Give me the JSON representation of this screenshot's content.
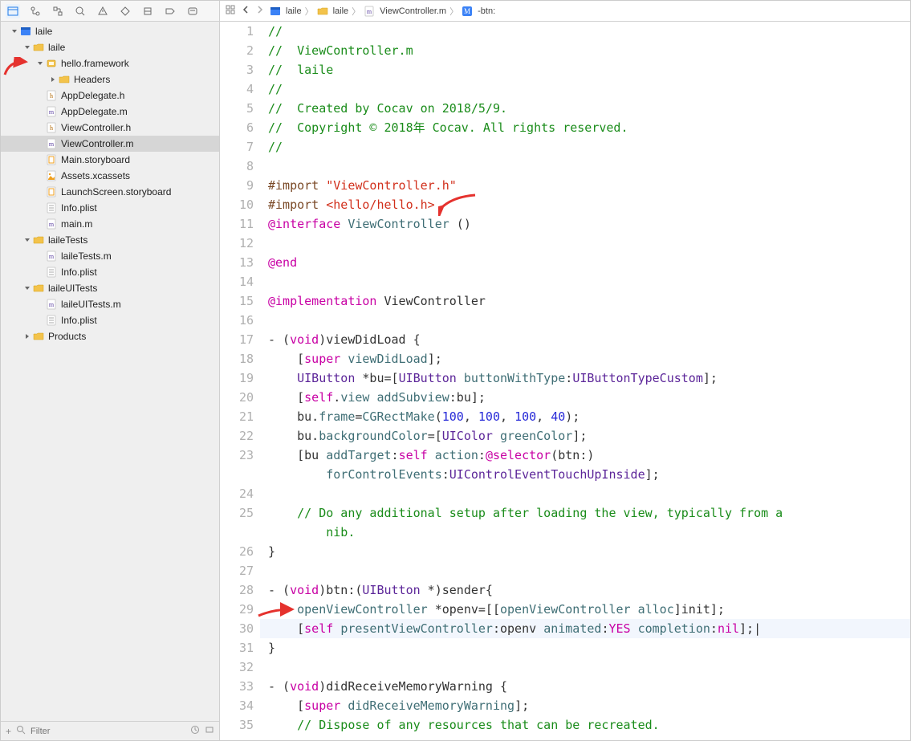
{
  "toolbar": {
    "filter_placeholder": "Filter"
  },
  "breadcrumb": {
    "items": [
      "laile",
      "laile",
      "ViewController.m",
      "-btn:"
    ]
  },
  "tree": [
    {
      "depth": 0,
      "icon": "proj",
      "label": "laile",
      "disclosure": "open"
    },
    {
      "depth": 1,
      "icon": "folder",
      "label": "laile",
      "disclosure": "open"
    },
    {
      "depth": 2,
      "icon": "framework",
      "label": "hello.framework",
      "disclosure": "open",
      "arrow": true
    },
    {
      "depth": 3,
      "icon": "folder",
      "label": "Headers",
      "disclosure": "closed"
    },
    {
      "depth": 2,
      "icon": "h",
      "label": "AppDelegate.h"
    },
    {
      "depth": 2,
      "icon": "m",
      "label": "AppDelegate.m"
    },
    {
      "depth": 2,
      "icon": "h",
      "label": "ViewController.h"
    },
    {
      "depth": 2,
      "icon": "m",
      "label": "ViewController.m",
      "selected": true
    },
    {
      "depth": 2,
      "icon": "storyboard",
      "label": "Main.storyboard"
    },
    {
      "depth": 2,
      "icon": "xcassets",
      "label": "Assets.xcassets"
    },
    {
      "depth": 2,
      "icon": "storyboard",
      "label": "LaunchScreen.storyboard"
    },
    {
      "depth": 2,
      "icon": "plist",
      "label": "Info.plist"
    },
    {
      "depth": 2,
      "icon": "m",
      "label": "main.m"
    },
    {
      "depth": 1,
      "icon": "folder",
      "label": "laileTests",
      "disclosure": "open"
    },
    {
      "depth": 2,
      "icon": "m",
      "label": "laileTests.m"
    },
    {
      "depth": 2,
      "icon": "plist",
      "label": "Info.plist"
    },
    {
      "depth": 1,
      "icon": "folder",
      "label": "laileUITests",
      "disclosure": "open"
    },
    {
      "depth": 2,
      "icon": "m",
      "label": "laileUITests.m"
    },
    {
      "depth": 2,
      "icon": "plist",
      "label": "Info.plist"
    },
    {
      "depth": 1,
      "icon": "folder",
      "label": "Products",
      "disclosure": "closed"
    }
  ],
  "code": [
    {
      "n": 1,
      "t": [
        [
          "//",
          "comment"
        ]
      ]
    },
    {
      "n": 2,
      "t": [
        [
          "//  ViewController.m",
          "comment"
        ]
      ]
    },
    {
      "n": 3,
      "t": [
        [
          "//  laile",
          "comment"
        ]
      ]
    },
    {
      "n": 4,
      "t": [
        [
          "//",
          "comment"
        ]
      ]
    },
    {
      "n": 5,
      "t": [
        [
          "//  Created by Cocav on 2018/5/9.",
          "comment"
        ]
      ]
    },
    {
      "n": 6,
      "t": [
        [
          "//  Copyright © 2018年 Cocav. All rights reserved.",
          "comment"
        ]
      ]
    },
    {
      "n": 7,
      "t": [
        [
          "//",
          "comment"
        ]
      ]
    },
    {
      "n": 8,
      "t": [
        [
          "",
          ""
        ]
      ]
    },
    {
      "n": 9,
      "t": [
        [
          "#import ",
          "import"
        ],
        [
          "\"ViewController.h\"",
          "string"
        ]
      ]
    },
    {
      "n": 10,
      "t": [
        [
          "#import ",
          "import"
        ],
        [
          "<hello/hello.h>",
          "string"
        ]
      ],
      "arrow": "right"
    },
    {
      "n": 11,
      "t": [
        [
          "@interface",
          "keyword"
        ],
        [
          " ",
          ""
        ],
        [
          "ViewController",
          "id"
        ],
        [
          " ()",
          ""
        ]
      ]
    },
    {
      "n": 12,
      "t": [
        [
          "",
          ""
        ]
      ]
    },
    {
      "n": 13,
      "t": [
        [
          "@end",
          "keyword"
        ]
      ]
    },
    {
      "n": 14,
      "t": [
        [
          "",
          ""
        ]
      ]
    },
    {
      "n": 15,
      "t": [
        [
          "@implementation",
          "keyword"
        ],
        [
          " ViewController",
          ""
        ]
      ]
    },
    {
      "n": 16,
      "t": [
        [
          "",
          ""
        ]
      ]
    },
    {
      "n": 17,
      "t": [
        [
          "- (",
          ""
        ],
        [
          "void",
          "keyword"
        ],
        [
          ")viewDidLoad {",
          ""
        ]
      ]
    },
    {
      "n": 18,
      "t": [
        [
          "    [",
          ""
        ],
        [
          "super",
          "keyword"
        ],
        [
          " ",
          ""
        ],
        [
          "viewDidLoad",
          "id"
        ],
        [
          "];",
          ""
        ]
      ]
    },
    {
      "n": 19,
      "t": [
        [
          "    ",
          ""
        ],
        [
          "UIButton",
          "type"
        ],
        [
          " *bu=[",
          ""
        ],
        [
          "UIButton",
          "type"
        ],
        [
          " ",
          ""
        ],
        [
          "buttonWithType",
          "id"
        ],
        [
          ":",
          ""
        ],
        [
          "UIButtonTypeCustom",
          "type"
        ],
        [
          "];",
          ""
        ]
      ]
    },
    {
      "n": 20,
      "t": [
        [
          "    [",
          ""
        ],
        [
          "self",
          "self"
        ],
        [
          ".",
          ""
        ],
        [
          "view",
          "id"
        ],
        [
          " ",
          ""
        ],
        [
          "addSubview",
          "id"
        ],
        [
          ":bu];",
          ""
        ]
      ]
    },
    {
      "n": 21,
      "t": [
        [
          "    bu.",
          ""
        ],
        [
          "frame",
          "id"
        ],
        [
          "=",
          ""
        ],
        [
          "CGRectMake",
          "id"
        ],
        [
          "(",
          ""
        ],
        [
          "100",
          "number"
        ],
        [
          ", ",
          ""
        ],
        [
          "100",
          "number"
        ],
        [
          ", ",
          ""
        ],
        [
          "100",
          "number"
        ],
        [
          ", ",
          ""
        ],
        [
          "40",
          "number"
        ],
        [
          ");",
          ""
        ]
      ]
    },
    {
      "n": 22,
      "t": [
        [
          "    bu.",
          ""
        ],
        [
          "backgroundColor",
          "id"
        ],
        [
          "=[",
          ""
        ],
        [
          "UIColor",
          "type"
        ],
        [
          " ",
          ""
        ],
        [
          "greenColor",
          "id"
        ],
        [
          "];",
          ""
        ]
      ]
    },
    {
      "n": 23,
      "t": [
        [
          "    [bu ",
          ""
        ],
        [
          "addTarget",
          "id"
        ],
        [
          ":",
          ""
        ],
        [
          "self",
          "self"
        ],
        [
          " ",
          ""
        ],
        [
          "action",
          "id"
        ],
        [
          ":",
          ""
        ],
        [
          "@selector",
          "keyword"
        ],
        [
          "(btn:)",
          ""
        ]
      ]
    },
    {
      "n": "",
      "t": [
        [
          "        ",
          ""
        ],
        [
          "forControlEvents",
          "id"
        ],
        [
          ":",
          ""
        ],
        [
          "UIControlEventTouchUpInside",
          "type"
        ],
        [
          "];",
          ""
        ]
      ]
    },
    {
      "n": 24,
      "t": [
        [
          "",
          ""
        ]
      ]
    },
    {
      "n": 25,
      "t": [
        [
          "    ",
          ""
        ],
        [
          "// Do any additional setup after loading the view, typically from a",
          "comment"
        ]
      ]
    },
    {
      "n": "",
      "t": [
        [
          "        ",
          ""
        ],
        [
          "nib.",
          "comment"
        ]
      ]
    },
    {
      "n": 26,
      "t": [
        [
          "}",
          ""
        ]
      ]
    },
    {
      "n": 27,
      "t": [
        [
          "",
          ""
        ]
      ]
    },
    {
      "n": 28,
      "t": [
        [
          "- (",
          ""
        ],
        [
          "void",
          "keyword"
        ],
        [
          ")btn:(",
          ""
        ],
        [
          "UIButton",
          "type"
        ],
        [
          " *)sender{",
          ""
        ]
      ]
    },
    {
      "n": 29,
      "t": [
        [
          "    ",
          ""
        ],
        [
          "openViewController",
          "id"
        ],
        [
          " *openv=[[",
          ""
        ],
        [
          "openViewController",
          "id"
        ],
        [
          " ",
          ""
        ],
        [
          "alloc",
          "id"
        ],
        [
          "]init];",
          ""
        ]
      ],
      "arrow": "left"
    },
    {
      "n": 30,
      "t": [
        [
          "    [",
          ""
        ],
        [
          "self",
          "self"
        ],
        [
          " ",
          ""
        ],
        [
          "presentViewController",
          "id"
        ],
        [
          ":openv ",
          ""
        ],
        [
          "animated",
          "id"
        ],
        [
          ":",
          ""
        ],
        [
          "YES",
          "keyword"
        ],
        [
          " ",
          ""
        ],
        [
          "completion",
          "id"
        ],
        [
          ":",
          ""
        ],
        [
          "nil",
          "keyword"
        ],
        [
          "];|",
          ""
        ]
      ],
      "hl": true
    },
    {
      "n": 31,
      "t": [
        [
          "}",
          ""
        ]
      ]
    },
    {
      "n": 32,
      "t": [
        [
          "",
          ""
        ]
      ]
    },
    {
      "n": 33,
      "t": [
        [
          "- (",
          ""
        ],
        [
          "void",
          "keyword"
        ],
        [
          ")didReceiveMemoryWarning {",
          ""
        ]
      ]
    },
    {
      "n": 34,
      "t": [
        [
          "    [",
          ""
        ],
        [
          "super",
          "keyword"
        ],
        [
          " ",
          ""
        ],
        [
          "didReceiveMemoryWarning",
          "id"
        ],
        [
          "];",
          ""
        ]
      ]
    },
    {
      "n": 35,
      "t": [
        [
          "    ",
          ""
        ],
        [
          "// Dispose of any resources that can be recreated.",
          "comment"
        ]
      ]
    }
  ]
}
